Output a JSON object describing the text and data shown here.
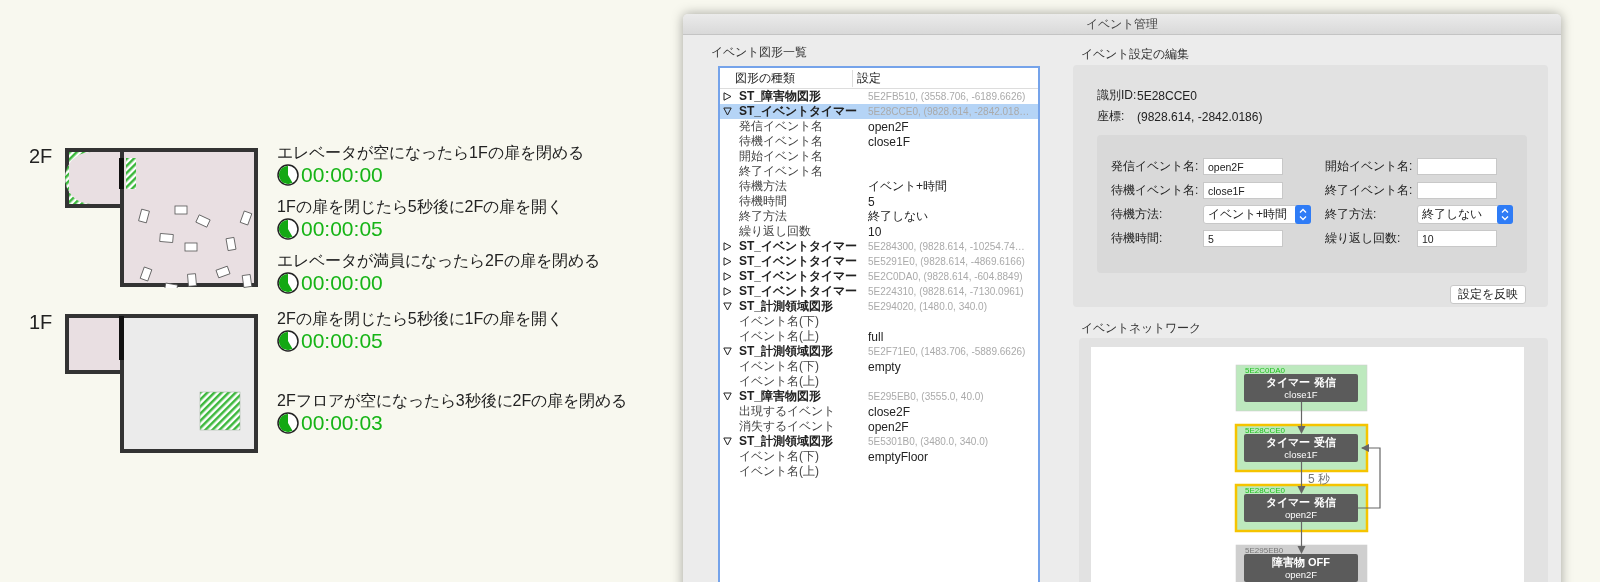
{
  "floors": [
    {
      "label": "2F",
      "kind": "upper",
      "events": [
        {
          "text": "エレベータが空になったら1Fの扉を閉める",
          "time": "00:00:00"
        },
        {
          "text": "1Fの扉を閉じたら5秒後に2Fの扉を開く",
          "time": "00:00:05"
        },
        {
          "text": "エレベータが満員になったら2Fの扉を閉める",
          "time": "00:00:00"
        }
      ]
    },
    {
      "label": "1F",
      "kind": "lower",
      "events": [
        {
          "text": "2Fの扉を閉じたら5秒後に1Fの扉を開く",
          "time": "00:00:05"
        },
        {
          "text": "2Fフロアが空になったら3秒後に2Fの扉を閉める",
          "time": "00:00:03"
        }
      ]
    }
  ],
  "window": {
    "title": "イベント管理"
  },
  "shape_list": {
    "title": "イベント図形一覧",
    "columns": [
      "図形の種類",
      "設定"
    ],
    "items": [
      {
        "name": "ST_障害物図形",
        "value": "5E2FB510, (3558.706, -6189.6626)",
        "expanded": false,
        "selected": false
      },
      {
        "name": "ST_イベントタイマー",
        "value": "5E28CCE0, (9828.614, -2842.018…",
        "expanded": true,
        "selected": true,
        "children": [
          {
            "name": "発信イベント名",
            "value": "open2F"
          },
          {
            "name": "待機イベント名",
            "value": "close1F"
          },
          {
            "name": "開始イベント名"
          },
          {
            "name": "終了イベント名"
          },
          {
            "name": "待機方法",
            "value": "イベント+時間"
          },
          {
            "name": "待機時間",
            "value": "5"
          },
          {
            "name": "終了方法",
            "value": "終了しない"
          },
          {
            "name": "繰り返し回数",
            "value": "10"
          }
        ]
      },
      {
        "name": "ST_イベントタイマー",
        "value": "5E284300, (9828.614, -10254.74…",
        "expanded": false,
        "selected": false
      },
      {
        "name": "ST_イベントタイマー",
        "value": "5E5291E0, (9828.614, -4869.6166)",
        "expanded": false,
        "selected": false
      },
      {
        "name": "ST_イベントタイマー",
        "value": "5E2C0DA0, (9828.614, -604.8849)",
        "expanded": false,
        "selected": false
      },
      {
        "name": "ST_イベントタイマー",
        "value": "5E224310, (9828.614, -7130.0961)",
        "expanded": false,
        "selected": false
      },
      {
        "name": "ST_計測領域図形",
        "value": "5E294020, (1480.0, 340.0)",
        "expanded": true,
        "selected": false,
        "children": [
          {
            "name": "イベント名(下)"
          },
          {
            "name": "イベント名(上)",
            "value": "full"
          }
        ]
      },
      {
        "name": "ST_計測領域図形",
        "value": "5E2F71E0, (1483.706, -5889.6626)",
        "expanded": true,
        "selected": false,
        "children": [
          {
            "name": "イベント名(下)",
            "value": "empty"
          },
          {
            "name": "イベント名(上)"
          }
        ]
      },
      {
        "name": "ST_障害物図形",
        "value": "5E295EB0, (3555.0, 40.0)",
        "expanded": true,
        "selected": false,
        "children": [
          {
            "name": "出現するイベント",
            "value": "close2F"
          },
          {
            "name": "消失するイベント",
            "value": "open2F"
          }
        ]
      },
      {
        "name": "ST_計測領域図形",
        "value": "5E5301B0, (3480.0, 340.0)",
        "expanded": true,
        "selected": false,
        "children": [
          {
            "name": "イベント名(下)",
            "value": "emptyFloor"
          },
          {
            "name": "イベント名(上)"
          }
        ]
      }
    ]
  },
  "editor": {
    "title": "イベント設定の編集",
    "id_label": "識別ID:",
    "id": "5E28CCE0",
    "coord_label": "座標:",
    "coord": "(9828.614, -2842.0186)",
    "fields_left": [
      {
        "label": "発信イベント名:",
        "kind": "text",
        "value": "open2F"
      },
      {
        "label": "待機イベント名:",
        "kind": "text",
        "value": "close1F"
      },
      {
        "label": "待機方法:",
        "kind": "select",
        "value": "イベント+時間"
      },
      {
        "label": "待機時間:",
        "kind": "text",
        "value": "5"
      }
    ],
    "fields_right": [
      {
        "label": "開始イベント名:",
        "kind": "text"
      },
      {
        "label": "終了イベント名:",
        "kind": "text"
      },
      {
        "label": "終了方法:",
        "kind": "select",
        "value": "終了しない"
      },
      {
        "label": "繰り返し回数:",
        "kind": "text",
        "value": "10"
      }
    ],
    "apply_button": "設定を反映"
  },
  "network": {
    "title": "イベントネットワーク",
    "nodes": [
      {
        "id": "5E2C0DA0",
        "title": "タイマー 発信",
        "event": "close1F",
        "kind": "timer",
        "selected": false,
        "links_down": true,
        "loops_back": false
      },
      {
        "id": "5E28CCE0",
        "title": "タイマー 受信",
        "event": "close1F",
        "kind": "timer",
        "selected": true,
        "links_down": true,
        "link_label": "5 秒",
        "loops_back": false
      },
      {
        "id": "5E28CCE0",
        "title": "タイマー 発信",
        "event": "open2F",
        "kind": "timer",
        "selected": true,
        "links_down": true,
        "loops_back": true
      },
      {
        "id": "5E295EB0",
        "title": "障害物 OFF",
        "event": "open2F",
        "kind": "obstacle",
        "selected": false,
        "links_down": false,
        "loops_back": false
      }
    ]
  }
}
